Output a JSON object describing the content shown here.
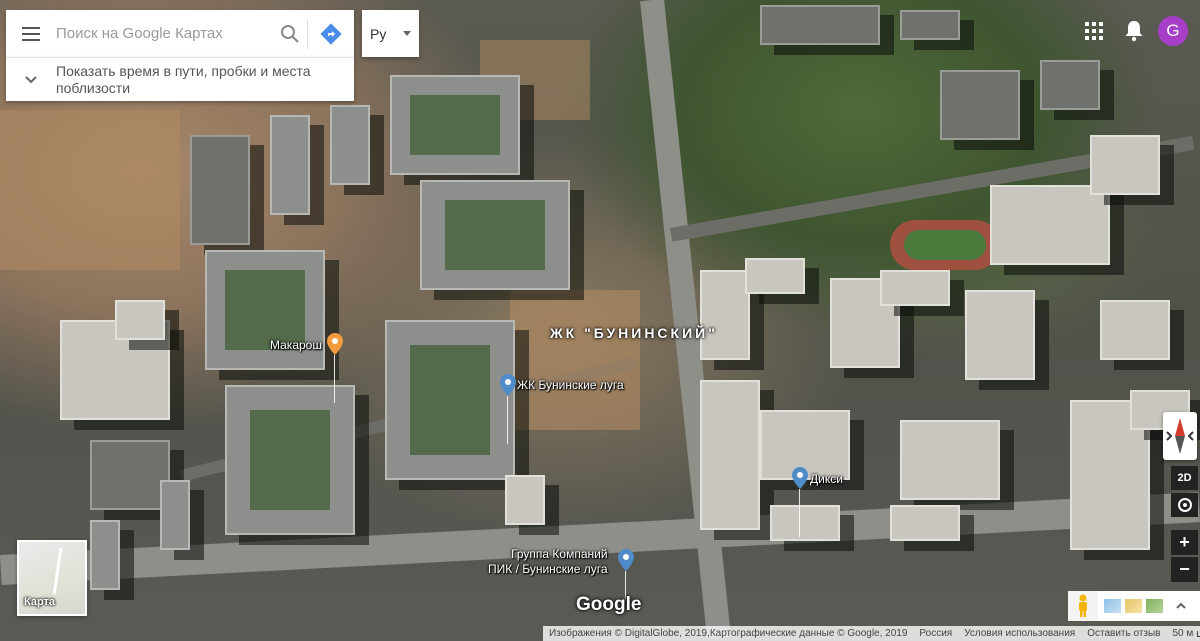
{
  "search": {
    "placeholder": "Поиск на Google Картах"
  },
  "language": {
    "selected": "Ру"
  },
  "info_bar": {
    "text": "Показать время в пути, пробки и места поблизости"
  },
  "account": {
    "avatar_letter": "G"
  },
  "places": {
    "makarosh": "Макарош",
    "zhk_luga": "ЖК Бунинские луга",
    "district": "ЖК \"БУНИНСКИЙ\"",
    "diksi": "Дикси",
    "pik_line1": "Группа Компаний",
    "pik_line2": "ПИК / Бунинские луга"
  },
  "pin_colors": {
    "food": "#f19a3e",
    "blue": "#4f8cc9"
  },
  "minimap": {
    "label": "Карта"
  },
  "logo": "Google",
  "controls": {
    "mode_2d": "2D",
    "zoom_in": "+",
    "zoom_out": "−"
  },
  "footer": {
    "attribution": "Изображения © DigitalGlobe, 2019,Картографические данные © Google, 2019",
    "country": "Россия",
    "terms": "Условия использования",
    "feedback": "Оставить отзыв",
    "scale": "50 м"
  }
}
